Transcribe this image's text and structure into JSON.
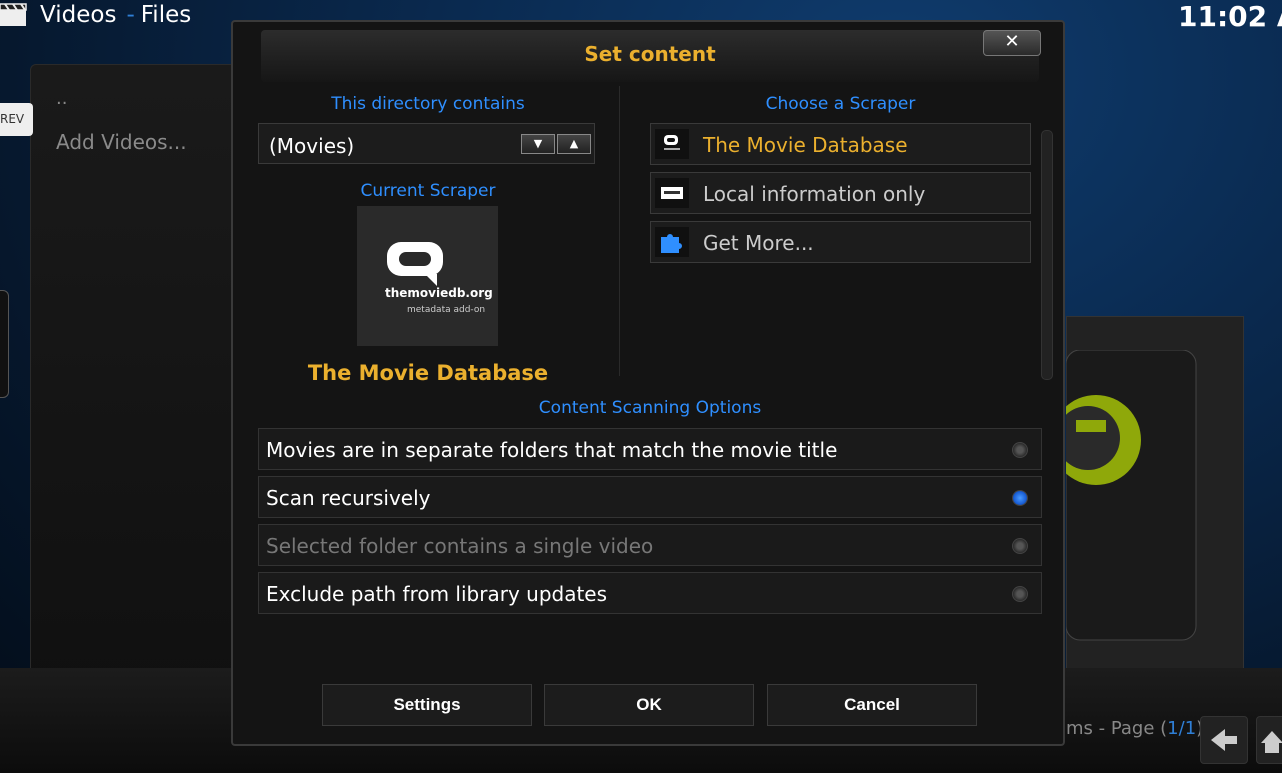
{
  "header": {
    "window": "Videos",
    "separator": "-",
    "section": "Files",
    "clock": "11:02 A"
  },
  "background_list": {
    "parent": "..",
    "add_item": "Add Videos...",
    "side_tab": "REV"
  },
  "footer": {
    "items_text": "ms - Page (",
    "page": "1/1",
    "close_paren": ")"
  },
  "dialog": {
    "title": "Set content",
    "close_symbol": "✕",
    "directory_label": "This directory contains",
    "directory_value": "(Movies)",
    "current_scraper_label": "Current Scraper",
    "current_scraper_logo_text": "themoviedb.org",
    "current_scraper_logo_sub": "metadata add-on",
    "current_scraper_name": "The Movie Database",
    "choose_scraper_label": "Choose a Scraper",
    "scrapers": [
      {
        "label": "The Movie Database",
        "icon": "tmdb-icon",
        "selected": true
      },
      {
        "label": "Local information only",
        "icon": "nfo-icon",
        "selected": false
      },
      {
        "label": "Get More...",
        "icon": "puzzle-icon",
        "selected": false
      }
    ],
    "scanning_label": "Content Scanning Options",
    "options": [
      {
        "label": "Movies are in separate folders that match the movie title",
        "checked": false,
        "disabled": false
      },
      {
        "label": "Scan recursively",
        "checked": true,
        "disabled": false
      },
      {
        "label": "Selected folder contains a single video",
        "checked": false,
        "disabled": true
      },
      {
        "label": "Exclude path from library updates",
        "checked": false,
        "disabled": false
      }
    ],
    "buttons": {
      "settings": "Settings",
      "ok": "OK",
      "cancel": "Cancel"
    }
  },
  "colors": {
    "accent_orange": "#ebb02e",
    "accent_blue": "#2f8fff"
  }
}
